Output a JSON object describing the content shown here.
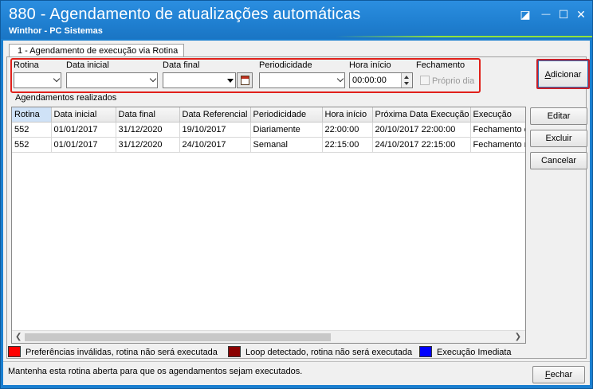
{
  "window": {
    "title": "880 - Agendamento de atualizações automáticas",
    "subtitle": "Winthor - PC Sistemas",
    "restore_glyph": "◪",
    "minimize_glyph": "—",
    "maximize_glyph": "☐",
    "close_glyph": "✕"
  },
  "tab": {
    "label": "1 - Agendamento de execução via Rotina"
  },
  "filters": {
    "rotina_label": "Rotina",
    "rotina_value": "",
    "data_inicial_label": "Data inicial",
    "data_inicial_value": "",
    "data_final_label": "Data final",
    "data_final_value": "",
    "periodicidade_label": "Periodicidade",
    "periodicidade_value": "",
    "hora_inicio_label": "Hora início",
    "hora_inicio_value": "00:00:00",
    "fechamento_label": "Fechamento",
    "proprio_dia_label": "Próprio dia",
    "proprio_dia_checked": false
  },
  "buttons": {
    "adicionar_accel": "A",
    "adicionar_rest": "dicionar",
    "editar": "Editar",
    "excluir": "Excluir",
    "cancelar": "Cancelar",
    "fechar_accel": "F",
    "fechar_rest": "echar"
  },
  "grid": {
    "group_label": "Agendamentos realizados",
    "columns": [
      "Rotina",
      "Data inicial",
      "Data final",
      "Data Referencial",
      "Periodicidade",
      "Hora início",
      "Próxima Data Execução",
      "Execução"
    ],
    "rows": [
      [
        "552",
        "01/01/2017",
        "31/12/2020",
        "19/10/2017",
        "Diariamente",
        "22:00:00",
        "20/10/2017 22:00:00",
        "Fechamento di"
      ],
      [
        "552",
        "01/01/2017",
        "31/12/2020",
        "24/10/2017",
        "Semanal",
        "22:15:00",
        "24/10/2017 22:15:00",
        "Fechamento no"
      ]
    ]
  },
  "legend": [
    {
      "label": "Preferências inválidas, rotina não será executada",
      "color": "#ff0000"
    },
    {
      "label": "Loop detectado, rotina não será executada",
      "color": "#8b0000"
    },
    {
      "label": "Execução Imediata",
      "color": "#0000ff"
    }
  ],
  "status": {
    "text": "Mantenha esta rotina aberta para que os agendamentos sejam executados."
  },
  "colors": {
    "titlebar": "#1f7fd0",
    "highlight_border": "#e0201a"
  }
}
